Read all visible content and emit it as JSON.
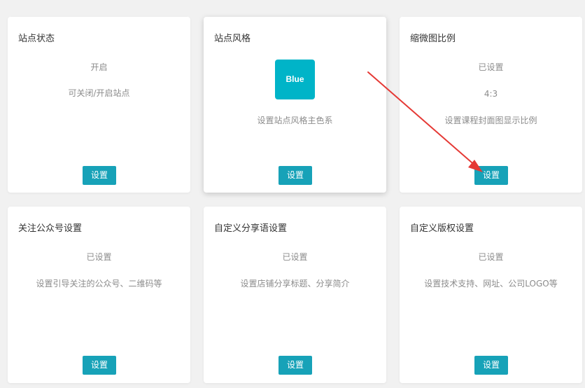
{
  "cards": [
    {
      "title": "站点状态",
      "status": "开启",
      "desc": "可关闭/开启站点",
      "button": "设置"
    },
    {
      "title": "站点风格",
      "swatch_label": "Blue",
      "swatch_color": "#00b4c8",
      "desc": "设置站点风格主色系",
      "button": "设置"
    },
    {
      "title": "缩微图比例",
      "status": "已设置",
      "value": "4:3",
      "desc": "设置课程封面图显示比例",
      "button": "设置"
    },
    {
      "title": "关注公众号设置",
      "status": "已设置",
      "desc": "设置引导关注的公众号、二维码等",
      "button": "设置"
    },
    {
      "title": "自定义分享语设置",
      "status": "已设置",
      "desc": "设置店铺分享标题、分享简介",
      "button": "设置"
    },
    {
      "title": "自定义版权设置",
      "status": "已设置",
      "desc": "设置技术支持、网址、公司LOGO等",
      "button": "设置"
    }
  ],
  "colors": {
    "page_background": "#f1f1f1",
    "card_background": "#ffffff",
    "button": "#17a2b8",
    "annotation_arrow": "#e53935"
  }
}
